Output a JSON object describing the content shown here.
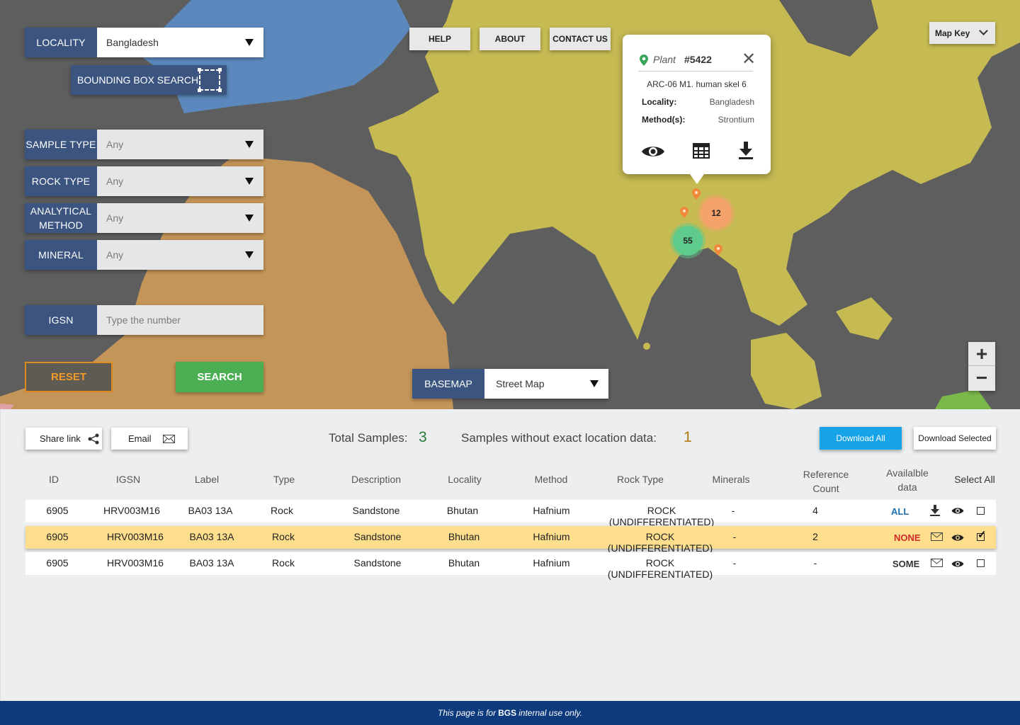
{
  "filters": {
    "locality": {
      "label": "LOCALITY",
      "value": "Bangladesh"
    },
    "bounding_box": "BOUNDING BOX SEARCH",
    "sample_type": {
      "label": "SAMPLE TYPE",
      "value": "Any"
    },
    "rock_type": {
      "label": "ROCK TYPE",
      "value": "Any"
    },
    "analytical_method": {
      "label": "ANALYTICAL METHOD",
      "value": "Any"
    },
    "mineral": {
      "label": "MINERAL",
      "value": "Any"
    },
    "igsn": {
      "label": "IGSN",
      "placeholder": "Type the number"
    },
    "reset": "RESET",
    "search": "SEARCH"
  },
  "top_nav": {
    "help": "HELP",
    "about": "ABOUT",
    "contact": "CONTACT US",
    "map_key": "Map Key"
  },
  "basemap": {
    "label": "BASEMAP",
    "value": "Street Map"
  },
  "zoom": {
    "in": "+",
    "out": "−"
  },
  "popup": {
    "title": "Plant",
    "number": "#5422",
    "label": "ARC-06 M1. human skel 6",
    "locality_label": "Locality:",
    "locality_value": "Bangladesh",
    "method_label": "Method(s):",
    "method_value": "Strontium"
  },
  "clusters": [
    {
      "count": "12",
      "color": "#f5a26b"
    },
    {
      "count": "55",
      "color": "#5ecb8c"
    }
  ],
  "panel": {
    "share": "Share link",
    "email": "Email",
    "total_label": "Total Samples:",
    "total_value": "3",
    "noloc_label": "Samples without exact location data:",
    "noloc_value": "1",
    "download_all": "Download All",
    "download_selected": "Download Selected"
  },
  "table": {
    "headers": {
      "id": "ID",
      "igsn": "IGSN",
      "label": "Label",
      "type": "Type",
      "description": "Description",
      "locality": "Locality",
      "method": "Method",
      "rock_type": "Rock Type",
      "minerals": "Minerals",
      "reference_count": "Reference Count",
      "available_data": "Availalble data",
      "select_all": "Select All"
    },
    "rows": [
      {
        "id": "6905",
        "igsn": "HRV003M16",
        "label": "BA03 13A",
        "type": "Rock",
        "description": "Sandstone",
        "locality": "Bhutan",
        "method": "Hafnium",
        "rock_type": "ROCK (UNDIFFERENTIATED)",
        "minerals": "-",
        "reference_count": "4",
        "available": "ALL",
        "available_color": "#1a6fb5",
        "selected": false
      },
      {
        "id": "6905",
        "igsn": "HRV003M16",
        "label": "BA03 13A",
        "type": "Rock",
        "description": "Sandstone",
        "locality": "Bhutan",
        "method": "Hafnium",
        "rock_type": "ROCK (UNDIFFERENTIATED)",
        "minerals": "-",
        "reference_count": "2",
        "available": "NONE",
        "available_color": "#d02b2b",
        "selected": true
      },
      {
        "id": "6905",
        "igsn": "HRV003M16",
        "label": "BA03 13A",
        "type": "Rock",
        "description": "Sandstone",
        "locality": "Bhutan",
        "method": "Hafnium",
        "rock_type": "ROCK (UNDIFFERENTIATED)",
        "minerals": "-",
        "reference_count": "-",
        "available": "SOME",
        "available_color": "#333333",
        "selected": false
      }
    ]
  },
  "footer": {
    "pre": "This page is for",
    "brand": "BGS",
    "post": "internal use only."
  }
}
